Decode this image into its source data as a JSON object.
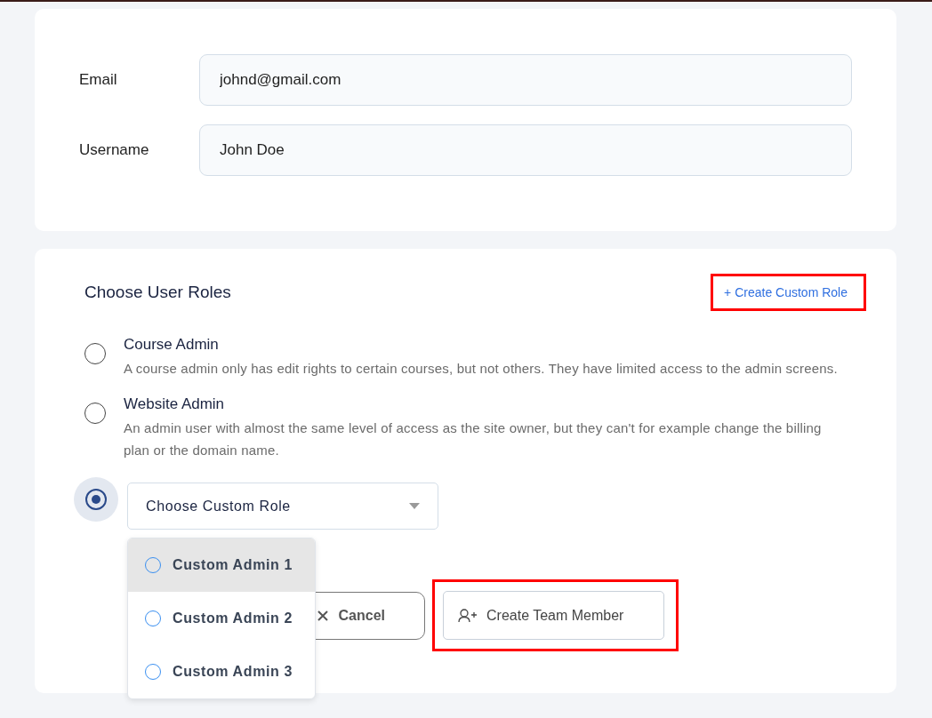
{
  "account": {
    "fields": [
      {
        "label": "Email",
        "value": "johnd@gmail.com"
      },
      {
        "label": "Username",
        "value": "John Doe"
      }
    ]
  },
  "roles": {
    "title": "Choose User Roles",
    "create_link": {
      "label": "+ Create Custom Role",
      "highlighted": true
    },
    "options": [
      {
        "kind": "role",
        "title": "Course Admin",
        "description": "A course admin only has edit rights to certain courses, but not others. They have limited access to the admin screens.",
        "selected": false
      },
      {
        "kind": "role",
        "title": "Website Admin",
        "description": "An admin user with almost the same level of access as the site owner, but they can't for example change the billing plan or the domain name.",
        "selected": false
      },
      {
        "kind": "custom",
        "placeholder": "Choose Custom Role",
        "selected": true
      }
    ],
    "dropdown": {
      "expanded": true,
      "items": [
        {
          "label": "Custom Admin 1",
          "selected": false,
          "hovered": true
        },
        {
          "label": "Custom Admin 2",
          "selected": false,
          "hovered": false
        },
        {
          "label": "Custom Admin 3",
          "selected": false,
          "hovered": false
        }
      ]
    },
    "cancel_button": {
      "label": "Cancel"
    },
    "create_button": {
      "label": "Create Team Member",
      "highlighted": true
    }
  }
}
